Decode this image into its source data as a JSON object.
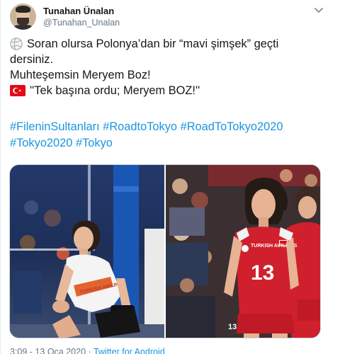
{
  "tweet": {
    "author_name": "Tunahan Ünalan",
    "author_handle": "@Tunahan_Unalan",
    "lines": [
      "Soran olursa Polonya’dan bir “mavi şimşek” geçti",
      "dersiniz.",
      "Muhteşemsin Meryem Boz!",
      "''Tek başına ordu; Meryem BOZ!''"
    ],
    "hashtags_line1": [
      "#FileninSultanları",
      "#RoadtoTokyo",
      "#RoadToTokyo2020"
    ],
    "hashtags_line2": [
      "#Tokyo2020",
      "#Tokyo"
    ],
    "footer_time": "3:09 - 13 Oca 2020",
    "footer_sep": "·",
    "footer_source": "Twitter for Android"
  },
  "photos": {
    "left_jersey_brand": "TURKISH AIRLINES",
    "right_jersey_brand": "TURKISH AIRLINES",
    "right_jersey_number": "13",
    "right_short_number": "13"
  },
  "colors": {
    "link": "#1b95e0",
    "text": "#14171a",
    "muted": "#657786",
    "jersey_red": "#d0202d"
  },
  "icons": {
    "line1": "volleyball-icon",
    "line4": "turkey-flag-icon",
    "menu": "chevron-down-icon"
  }
}
